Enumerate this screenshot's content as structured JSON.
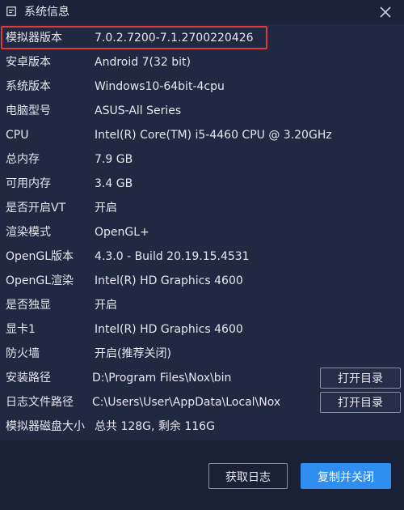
{
  "window": {
    "title": "系统信息",
    "icon": "window-info-icon",
    "close_icon": "close-icon"
  },
  "colors": {
    "background": "#1a2036",
    "content_background": "#202842",
    "highlight_border": "#e03a3a",
    "primary_button": "#2f8ef0"
  },
  "info": {
    "rows": [
      {
        "label": "模拟器版本",
        "value": "7.0.2.7200-7.1.2700220426"
      },
      {
        "label": "安卓版本",
        "value": "Android 7(32 bit)"
      },
      {
        "label": "系统版本",
        "value": "Windows10-64bit-4cpu"
      },
      {
        "label": "电脑型号",
        "value": "ASUS-All Series"
      },
      {
        "label": "CPU",
        "value": "Intel(R) Core(TM) i5-4460  CPU @ 3.20GHz"
      },
      {
        "label": "总内存",
        "value": "7.9 GB"
      },
      {
        "label": "可用内存",
        "value": "3.4 GB"
      },
      {
        "label": "是否开启VT",
        "value": "开启"
      },
      {
        "label": "渲染模式",
        "value": "OpenGL+"
      },
      {
        "label": "OpenGL版本",
        "value": "4.3.0 - Build 20.19.15.4531"
      },
      {
        "label": "OpenGL渲染",
        "value": "Intel(R) HD Graphics 4600"
      },
      {
        "label": "是否独显",
        "value": "开启"
      },
      {
        "label": "显卡1",
        "value": "Intel(R) HD Graphics 4600"
      },
      {
        "label": "防火墙",
        "value": "开启(推荐关闭)"
      },
      {
        "label": "安装路径",
        "value": "D:\\Program Files\\Nox\\bin"
      },
      {
        "label": "日志文件路径",
        "value": "C:\\Users\\User\\AppData\\Local\\Nox"
      },
      {
        "label": "模拟器磁盘大小",
        "value": "总共 128G, 剩余 116G"
      }
    ],
    "open_dir_label": "打开目录"
  },
  "footer": {
    "get_log_label": "获取日志",
    "copy_close_label": "复制并关闭"
  }
}
